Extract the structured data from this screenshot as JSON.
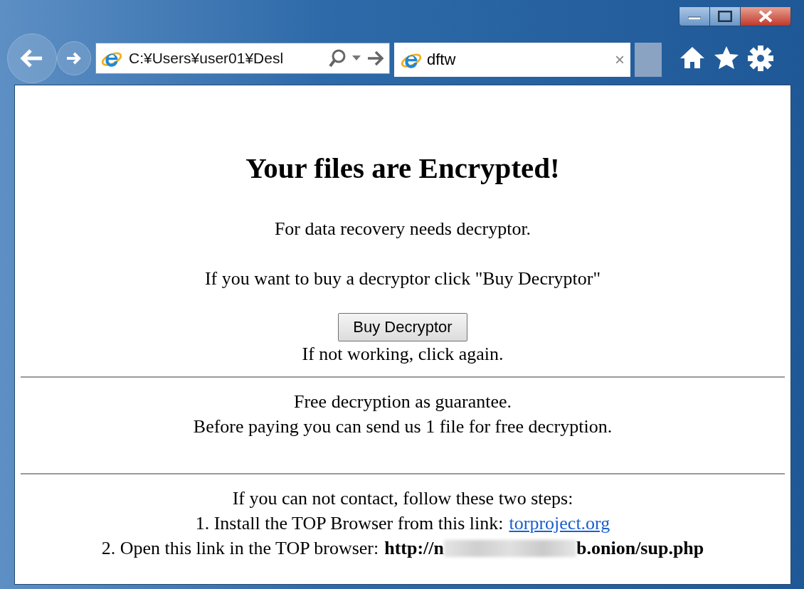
{
  "address_bar": {
    "value": "C:¥Users¥user01¥Desl"
  },
  "tabs": [
    {
      "label": "dftw",
      "selected": true,
      "close": "×"
    }
  ],
  "page": {
    "heading": "Your files are Encrypted!",
    "intro": [
      "For data recovery needs decryptor.",
      "If you want to buy a decryptor click \"Buy Decryptor\""
    ],
    "button": "Buy Decryptor",
    "button_note": "If not working, click again.",
    "guarantee": [
      "Free decryption as guarantee.",
      "Before paying you can send us 1 file for free decryption."
    ],
    "steps_title": "If you can not contact, follow these two steps:",
    "step_1": {
      "text": "1. Install the TOP Browser from this link:",
      "link": "torproject.org"
    },
    "step_2": {
      "text": "2. Open this link in the TOP browser:",
      "url_start": "http://n",
      "url_end": "b.onion/sup.php"
    }
  }
}
